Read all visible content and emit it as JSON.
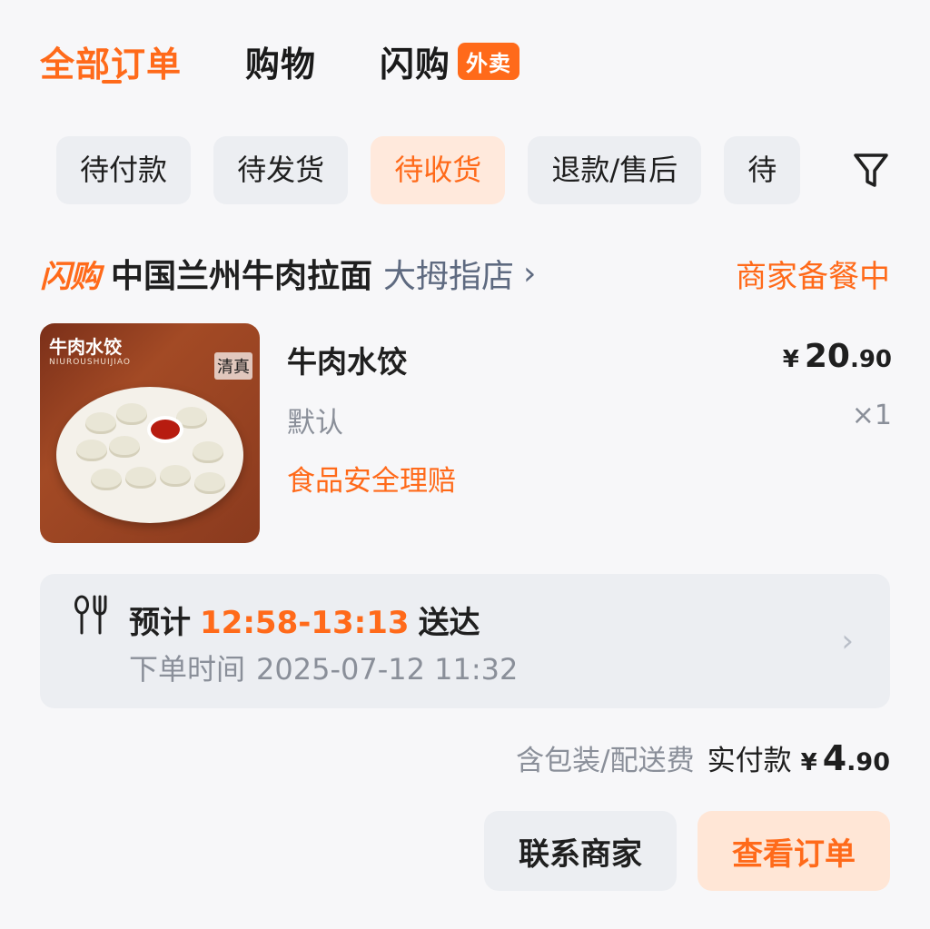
{
  "top_tabs": [
    {
      "label": "全部订单"
    },
    {
      "label": "购物"
    },
    {
      "label": "闪购",
      "badge": "外卖"
    }
  ],
  "filter_chips": [
    "待付款",
    "待发货",
    "待收货",
    "退款/售后",
    "待"
  ],
  "active_chip": "待收货",
  "store": {
    "brand": "闪购",
    "name": "中国兰州牛肉拉面",
    "branch": "大拇指店",
    "status": "商家备餐中"
  },
  "product": {
    "image_caption": "牛肉水饺",
    "image_caption_pinyin": "NIUROUSHUIJIAO",
    "image_tag": "清真",
    "name": "牛肉水饺",
    "spec": "默认",
    "safety_claim": "食品安全理赔",
    "price_currency": "¥",
    "price_int": "20",
    "price_dec": ".90",
    "quantity": "×1"
  },
  "delivery": {
    "prefix": "预计",
    "time_range": "12:58-13:13",
    "suffix": "送达",
    "order_time_label": "下单时间",
    "order_time": "2025-07-12 11:32"
  },
  "totals": {
    "note": "含包装/配送费",
    "paid_label": "实付款",
    "currency": "¥",
    "amount_int": "4",
    "amount_dec": ".90"
  },
  "buttons": {
    "contact": "联系商家",
    "view_order": "查看订单"
  },
  "colors": {
    "accent": "#ff6a1a",
    "chip_bg": "#eceef2",
    "chip_active_bg": "#ffe9dc",
    "muted_text": "#8a8f99"
  }
}
